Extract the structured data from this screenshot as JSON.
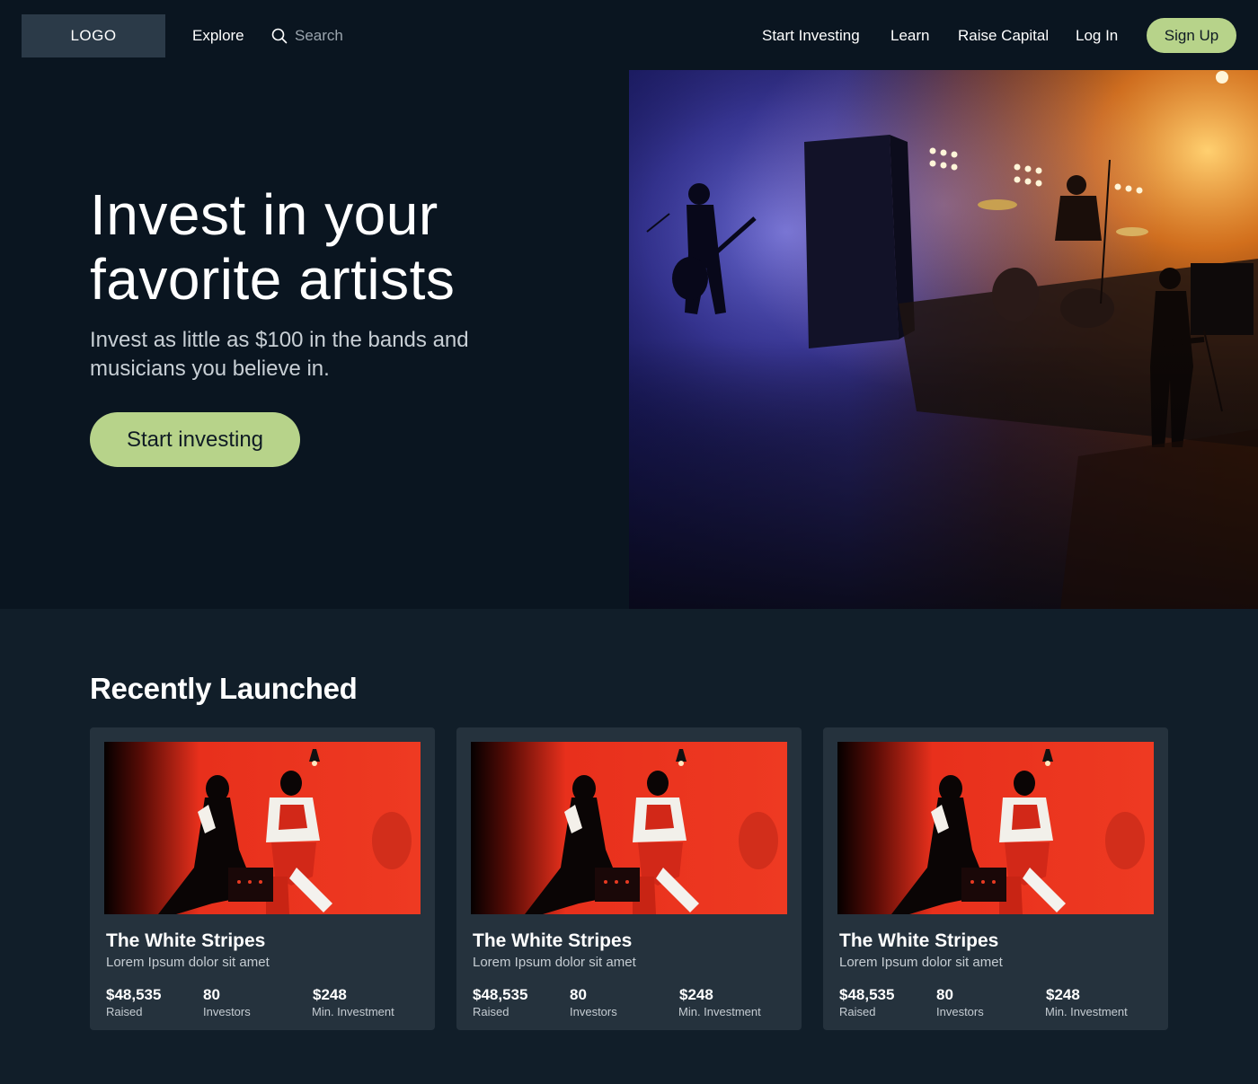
{
  "nav": {
    "logo": "LOGO",
    "explore": "Explore",
    "search_placeholder": "Search",
    "start_investing": "Start Investing",
    "learn": "Learn",
    "raise_capital": "Raise Capital",
    "log_in": "Log In",
    "sign_up": "Sign Up"
  },
  "hero": {
    "title_line1": "Invest in your",
    "title_line2": "favorite artists",
    "subtitle": "Invest as little as $100 in the bands and musicians you believe in.",
    "cta": "Start investing"
  },
  "recent": {
    "title": "Recently Launched",
    "cards": [
      {
        "name": "The White Stripes",
        "description": "Lorem Ipsum dolor sit amet",
        "raised": "$48,535",
        "raised_label": "Raised",
        "investors": "80",
        "investors_label": "Investors",
        "min_investment": "$248",
        "min_label": "Min. Investment"
      },
      {
        "name": "The White Stripes",
        "description": "Lorem Ipsum dolor sit amet",
        "raised": "$48,535",
        "raised_label": "Raised",
        "investors": "80",
        "investors_label": "Investors",
        "min_investment": "$248",
        "min_label": "Min. Investment"
      },
      {
        "name": "The White Stripes",
        "description": "Lorem Ipsum dolor sit amet",
        "raised": "$48,535",
        "raised_label": "Raised",
        "investors": "80",
        "investors_label": "Investors",
        "min_investment": "$248",
        "min_label": "Min. Investment"
      }
    ]
  },
  "colors": {
    "background": "#0a1520",
    "section_background": "#111e29",
    "card_background": "#25323d",
    "accent": "#b7d38a"
  }
}
